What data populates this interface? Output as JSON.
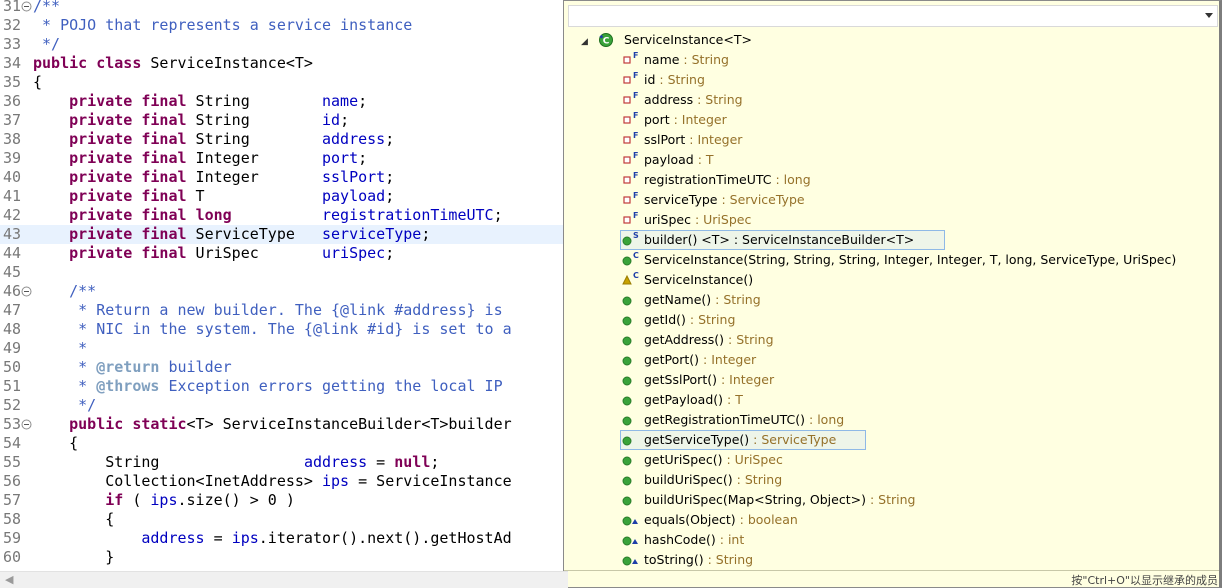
{
  "editor": {
    "lines": [
      {
        "n": "31",
        "fold": "minus",
        "segs": [
          [
            "cmt",
            "/**"
          ]
        ]
      },
      {
        "n": "32",
        "segs": [
          [
            "cmt",
            " * POJO that represents a service instance"
          ]
        ]
      },
      {
        "n": "33",
        "segs": [
          [
            "cmt",
            " */"
          ]
        ]
      },
      {
        "n": "34",
        "segs": [
          [
            "kw",
            "public"
          ],
          [
            "",
            " "
          ],
          [
            "kw",
            "class"
          ],
          [
            "",
            " ServiceInstance<T>"
          ]
        ]
      },
      {
        "n": "35",
        "segs": [
          [
            "",
            "{"
          ]
        ]
      },
      {
        "n": "36",
        "segs": [
          [
            "",
            "    "
          ],
          [
            "kw",
            "private"
          ],
          [
            "",
            " "
          ],
          [
            "kw",
            "final"
          ],
          [
            "",
            " String        "
          ],
          [
            "fld",
            "name"
          ],
          [
            "",
            ";"
          ]
        ]
      },
      {
        "n": "37",
        "segs": [
          [
            "",
            "    "
          ],
          [
            "kw",
            "private"
          ],
          [
            "",
            " "
          ],
          [
            "kw",
            "final"
          ],
          [
            "",
            " String        "
          ],
          [
            "fld",
            "id"
          ],
          [
            "",
            ";"
          ]
        ]
      },
      {
        "n": "38",
        "segs": [
          [
            "",
            "    "
          ],
          [
            "kw",
            "private"
          ],
          [
            "",
            " "
          ],
          [
            "kw",
            "final"
          ],
          [
            "",
            " String        "
          ],
          [
            "fld",
            "address"
          ],
          [
            "",
            ";"
          ]
        ]
      },
      {
        "n": "39",
        "segs": [
          [
            "",
            "    "
          ],
          [
            "kw",
            "private"
          ],
          [
            "",
            " "
          ],
          [
            "kw",
            "final"
          ],
          [
            "",
            " Integer       "
          ],
          [
            "fld",
            "port"
          ],
          [
            "",
            ";"
          ]
        ]
      },
      {
        "n": "40",
        "segs": [
          [
            "",
            "    "
          ],
          [
            "kw",
            "private"
          ],
          [
            "",
            " "
          ],
          [
            "kw",
            "final"
          ],
          [
            "",
            " Integer       "
          ],
          [
            "fld",
            "sslPort"
          ],
          [
            "",
            ";"
          ]
        ]
      },
      {
        "n": "41",
        "segs": [
          [
            "",
            "    "
          ],
          [
            "kw",
            "private"
          ],
          [
            "",
            " "
          ],
          [
            "kw",
            "final"
          ],
          [
            "",
            " T             "
          ],
          [
            "fld",
            "payload"
          ],
          [
            "",
            ";"
          ]
        ]
      },
      {
        "n": "42",
        "segs": [
          [
            "",
            "    "
          ],
          [
            "kw",
            "private"
          ],
          [
            "",
            " "
          ],
          [
            "kw",
            "final"
          ],
          [
            "",
            " "
          ],
          [
            "kw",
            "long"
          ],
          [
            "",
            "          "
          ],
          [
            "fld",
            "registrationTimeUTC"
          ],
          [
            "",
            ";"
          ]
        ]
      },
      {
        "n": "43",
        "current": true,
        "segs": [
          [
            "",
            "    "
          ],
          [
            "kw",
            "private"
          ],
          [
            "",
            " "
          ],
          [
            "kw",
            "final"
          ],
          [
            "",
            " ServiceType   "
          ],
          [
            "fld",
            "serviceType"
          ],
          [
            "",
            ";"
          ]
        ]
      },
      {
        "n": "44",
        "segs": [
          [
            "",
            "    "
          ],
          [
            "kw",
            "private"
          ],
          [
            "",
            " "
          ],
          [
            "kw",
            "final"
          ],
          [
            "",
            " UriSpec       "
          ],
          [
            "fld",
            "uriSpec"
          ],
          [
            "",
            ";"
          ]
        ]
      },
      {
        "n": "45",
        "segs": []
      },
      {
        "n": "46",
        "fold": "minus",
        "segs": [
          [
            "",
            "    "
          ],
          [
            "cmt",
            "/**"
          ]
        ]
      },
      {
        "n": "47",
        "segs": [
          [
            "cmt",
            "     * Return a new builder. The {@link #address} is"
          ]
        ]
      },
      {
        "n": "48",
        "segs": [
          [
            "cmt",
            "     * NIC in the system. The {@link #id} is set to a"
          ]
        ]
      },
      {
        "n": "49",
        "segs": [
          [
            "cmt",
            "     *"
          ]
        ]
      },
      {
        "n": "50",
        "segs": [
          [
            "cmt",
            "     * "
          ],
          [
            "tag",
            "@return"
          ],
          [
            "cmt",
            " builder"
          ]
        ]
      },
      {
        "n": "51",
        "segs": [
          [
            "cmt",
            "     * "
          ],
          [
            "tag",
            "@throws"
          ],
          [
            "cmt",
            " Exception errors getting the local IP"
          ]
        ]
      },
      {
        "n": "52",
        "segs": [
          [
            "cmt",
            "     */"
          ]
        ]
      },
      {
        "n": "53",
        "fold": "minus",
        "segs": [
          [
            "",
            "    "
          ],
          [
            "kw",
            "public"
          ],
          [
            "",
            " "
          ],
          [
            "kw",
            "static"
          ],
          [
            "",
            "<T> ServiceInstanceBuilder<T>builder"
          ]
        ]
      },
      {
        "n": "54",
        "segs": [
          [
            "",
            "    {"
          ]
        ]
      },
      {
        "n": "55",
        "segs": [
          [
            "",
            "        String                "
          ],
          [
            "fld",
            "address"
          ],
          [
            "",
            " = "
          ],
          [
            "kw",
            "null"
          ],
          [
            "",
            ";"
          ]
        ]
      },
      {
        "n": "56",
        "segs": [
          [
            "",
            "        Collection<InetAddress> "
          ],
          [
            "fld",
            "ips"
          ],
          [
            "",
            " = ServiceInstance"
          ]
        ]
      },
      {
        "n": "57",
        "segs": [
          [
            "",
            "        "
          ],
          [
            "kw",
            "if"
          ],
          [
            "",
            " ( "
          ],
          [
            "fld",
            "ips"
          ],
          [
            "",
            ".size() > 0 )"
          ]
        ]
      },
      {
        "n": "58",
        "segs": [
          [
            "",
            "        {"
          ]
        ]
      },
      {
        "n": "59",
        "segs": [
          [
            "",
            "            "
          ],
          [
            "fld",
            "address"
          ],
          [
            "",
            " = "
          ],
          [
            "fld",
            "ips"
          ],
          [
            "",
            ".iterator().next().getHostAd"
          ]
        ]
      },
      {
        "n": "60",
        "segs": [
          [
            "",
            "        }"
          ]
        ]
      }
    ]
  },
  "outline": {
    "filter_value": "",
    "root": {
      "label": "ServiceInstance<T>",
      "icon": "class-icon"
    },
    "members": [
      {
        "name": "name",
        "type": "String",
        "icon": "field-private-icon",
        "mod": "F"
      },
      {
        "name": "id",
        "type": "String",
        "icon": "field-private-icon",
        "mod": "F"
      },
      {
        "name": "address",
        "type": "String",
        "icon": "field-private-icon",
        "mod": "F"
      },
      {
        "name": "port",
        "type": "Integer",
        "icon": "field-private-icon",
        "mod": "F"
      },
      {
        "name": "sslPort",
        "type": "Integer",
        "icon": "field-private-icon",
        "mod": "F"
      },
      {
        "name": "payload",
        "type": "T",
        "icon": "field-private-icon",
        "mod": "F"
      },
      {
        "name": "registrationTimeUTC",
        "type": "long",
        "icon": "field-private-icon",
        "mod": "F"
      },
      {
        "name": "serviceType",
        "type": "ServiceType",
        "icon": "field-private-icon",
        "mod": "F"
      },
      {
        "name": "uriSpec",
        "type": "UriSpec",
        "icon": "field-private-icon",
        "mod": "F"
      },
      {
        "name": "builder() <T> : ServiceInstanceBuilder<T>",
        "type": "",
        "icon": "method-public-icon",
        "mod": "S",
        "boxed": true
      },
      {
        "name": "ServiceInstance(String, String, String, Integer, Integer, T, long, ServiceType, UriSpec)",
        "type": "",
        "icon": "method-public-icon",
        "mod": "C"
      },
      {
        "name": "ServiceInstance()",
        "type": "",
        "icon": "method-protected-icon",
        "mod": "C"
      },
      {
        "name": "getName()",
        "type": "String",
        "icon": "method-public-icon"
      },
      {
        "name": "getId()",
        "type": "String",
        "icon": "method-public-icon"
      },
      {
        "name": "getAddress()",
        "type": "String",
        "icon": "method-public-icon"
      },
      {
        "name": "getPort()",
        "type": "Integer",
        "icon": "method-public-icon"
      },
      {
        "name": "getSslPort()",
        "type": "Integer",
        "icon": "method-public-icon"
      },
      {
        "name": "getPayload()",
        "type": "T",
        "icon": "method-public-icon"
      },
      {
        "name": "getRegistrationTimeUTC()",
        "type": "long",
        "icon": "method-public-icon"
      },
      {
        "name": "getServiceType()",
        "type": "ServiceType",
        "icon": "method-public-icon",
        "selected": true
      },
      {
        "name": "getUriSpec()",
        "type": "UriSpec",
        "icon": "method-public-icon"
      },
      {
        "name": "buildUriSpec()",
        "type": "String",
        "icon": "method-public-icon"
      },
      {
        "name": "buildUriSpec(Map<String, Object>)",
        "type": "String",
        "icon": "method-public-icon"
      },
      {
        "name": "equals(Object)",
        "type": "boolean",
        "icon": "method-override-icon"
      },
      {
        "name": "hashCode()",
        "type": "int",
        "icon": "method-override-icon"
      },
      {
        "name": "toString()",
        "type": "String",
        "icon": "method-override-icon"
      }
    ],
    "status_text": "按\"Ctrl+O\"以显示继承的成员"
  },
  "colors": {
    "keyword": "#7f0055",
    "field": "#0000c0",
    "comment": "#3f5fbf",
    "javadoc_tag": "#7f9fbf",
    "type_suffix": "#95712a",
    "popup_bg": "#ffffe1",
    "current_line": "#e8f2fe",
    "method_public": "#3aa33a",
    "field_private": "#c03a3a",
    "method_protected": "#c8a200",
    "modifier_mark": "#1f3fa8"
  }
}
